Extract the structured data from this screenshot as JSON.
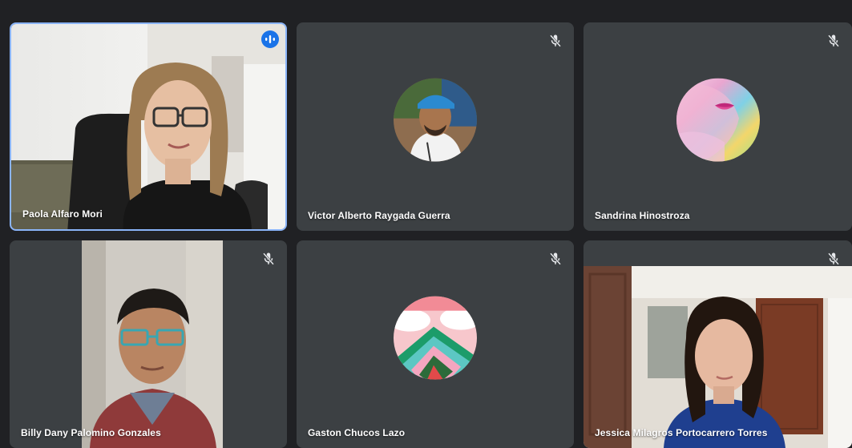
{
  "participants": [
    {
      "name": "Paola Alfaro Mori",
      "muted": false,
      "speaking": true
    },
    {
      "name": "Victor Alberto Raygada Guerra",
      "muted": true,
      "speaking": false
    },
    {
      "name": "Sandrina Hinostroza",
      "muted": true,
      "speaking": false
    },
    {
      "name": "Billy Dany Palomino Gonzales",
      "muted": true,
      "speaking": false
    },
    {
      "name": "Gaston Chucos Lazo",
      "muted": true,
      "speaking": false
    },
    {
      "name": "Jessica Milagros Portocarrero Torres",
      "muted": true,
      "speaking": false
    }
  ],
  "colors": {
    "background": "#202124",
    "tile": "#3c4043",
    "speaking_border": "#8ab4f8",
    "speaking_badge": "#1a73e8"
  },
  "icons": {
    "mute": "microphone-off-icon",
    "speaking": "audio-level-icon"
  }
}
